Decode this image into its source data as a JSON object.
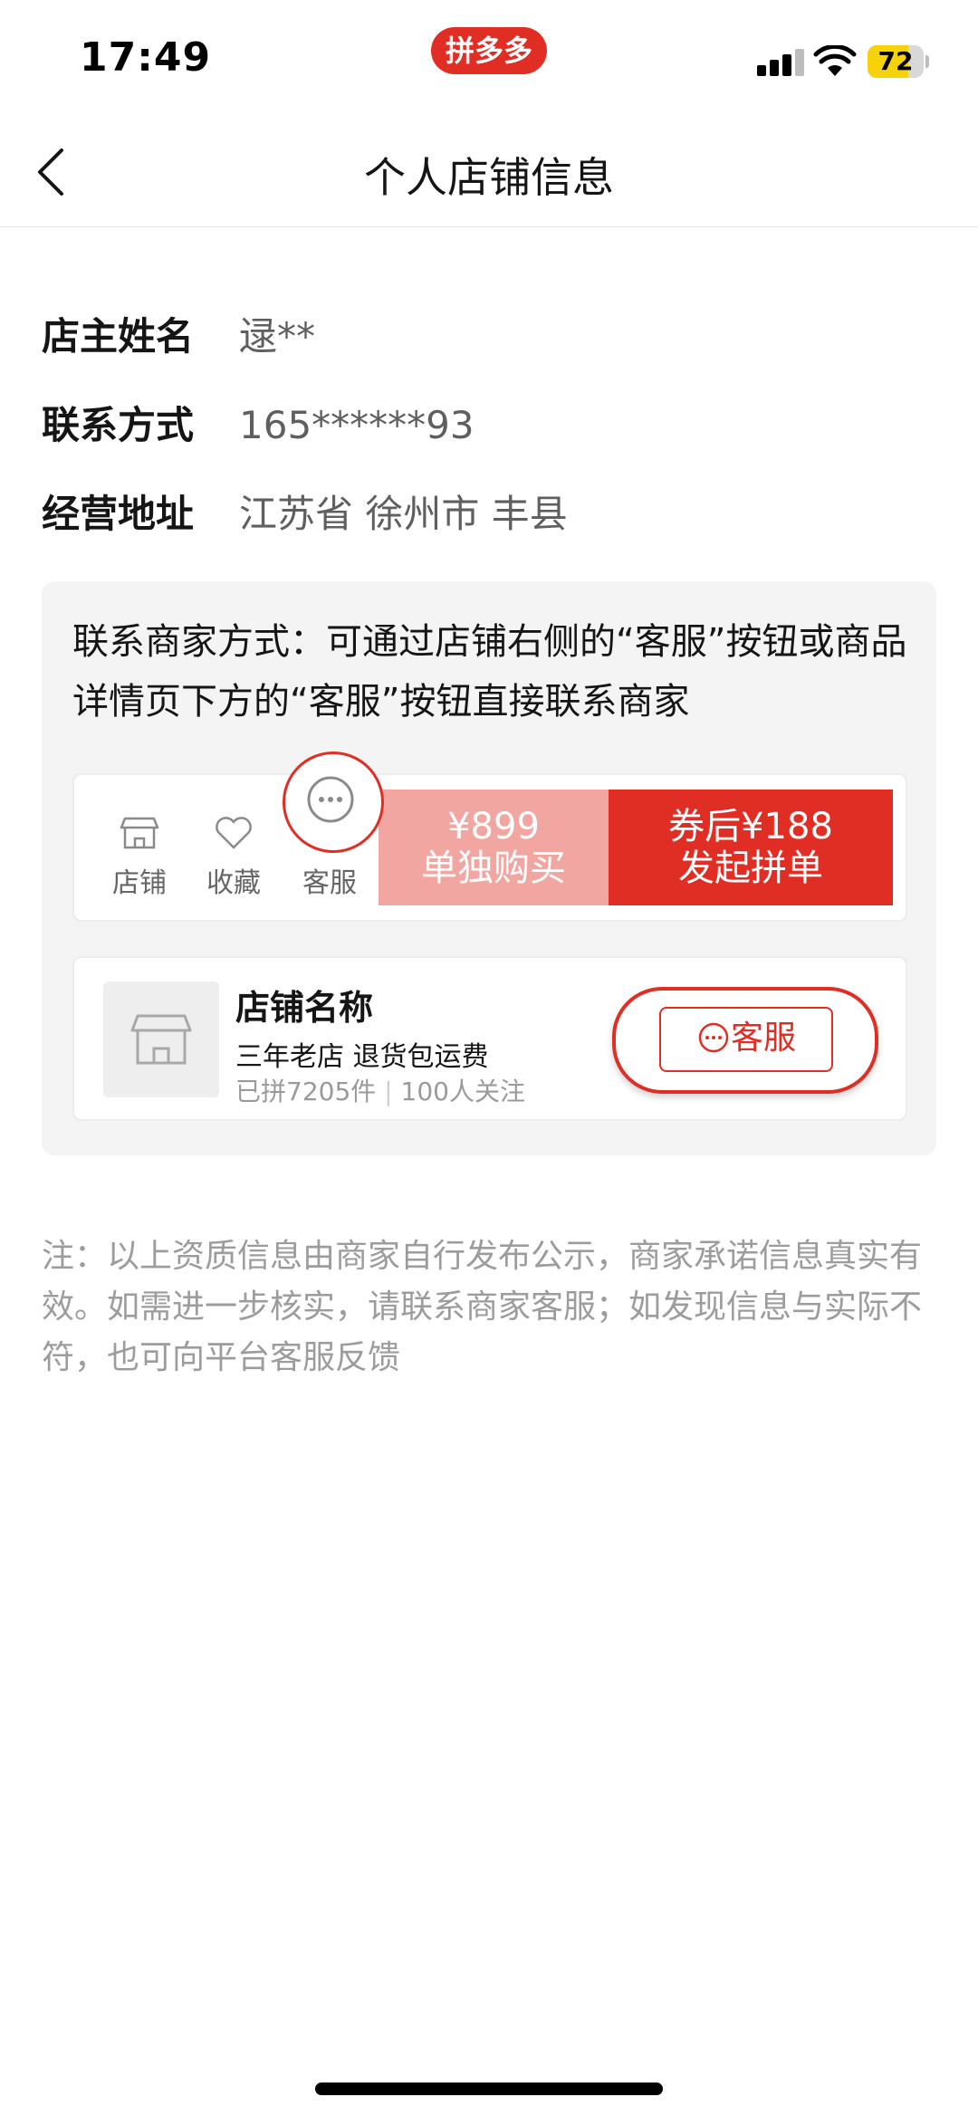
{
  "status_bar": {
    "time": "17:49",
    "app_badge": "拼多多",
    "battery": "72",
    "battery_level": 0.72
  },
  "nav": {
    "title": "个人店铺信息"
  },
  "info": [
    {
      "label": "店主姓名",
      "value": "逯**"
    },
    {
      "label": "联系方式",
      "value": "165******93"
    },
    {
      "label": "经营地址",
      "value": "江苏省 徐州市 丰县"
    }
  ],
  "contact_tip": "联系商家方式：可通过店铺右侧的“客服”按钮或商品详情页下方的“客服”按钮直接联系商家",
  "bottom_bar": {
    "store_label": "店铺",
    "favorite_label": "收藏",
    "service_label": "客服",
    "single_price": "¥899",
    "single_label": "单独购买",
    "group_price": "券后¥188",
    "group_label": "发起拼单"
  },
  "store_card": {
    "name": "店铺名称",
    "tags": "三年老店  退货包运费",
    "sold": "已拼7205件",
    "followers": "100人关注",
    "service_button": "客服"
  },
  "note": "注：以上资质信息由商家自行发布公示，商家承诺信息真实有效。如需进一步核实，请联系商家客服；如发现信息与实际不符，也可向平台客服反馈",
  "colors": {
    "brand_red": "#e02e24",
    "light_red": "#f2a6a2",
    "card_bg": "#f4f4f4"
  }
}
